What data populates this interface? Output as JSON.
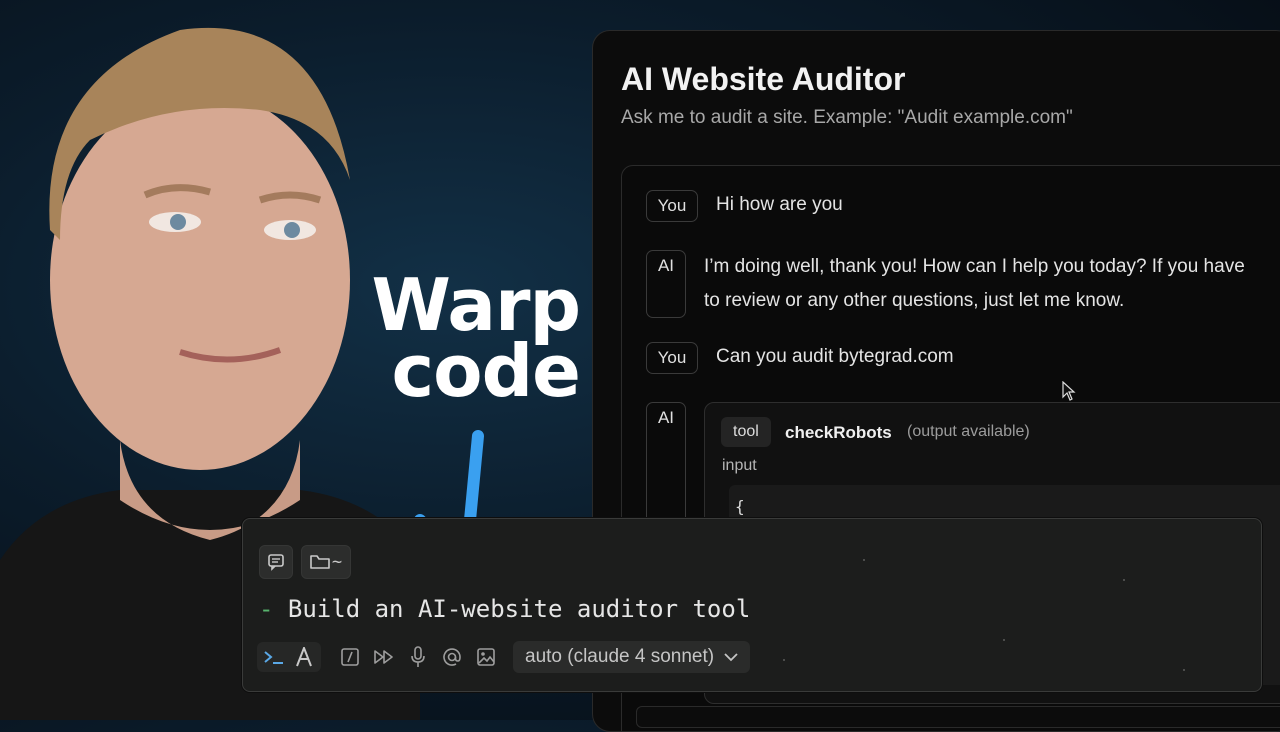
{
  "overlay": {
    "line1": "Warp",
    "line2": "code"
  },
  "auditor": {
    "title": "AI Website Auditor",
    "subtitle": "Ask me to audit a site. Example: \"Audit example.com\"",
    "messages": [
      {
        "role": "You",
        "text": "Hi how are you"
      },
      {
        "role": "AI",
        "line1": "I’m doing well, thank you! How can I help you today? If you have",
        "line2": "to review or any other questions, just let me know."
      },
      {
        "role": "You",
        "text": "Can you audit bytegrad.com"
      },
      {
        "role": "AI"
      }
    ],
    "tool": {
      "badge": "tool",
      "name": "checkRobots",
      "status": "(output available)",
      "input_label": "input",
      "code_first_line": "{"
    }
  },
  "warp": {
    "directory": "~",
    "prompt_prefix": "-",
    "prompt_text": " Build an AI-website auditor tool",
    "model": "auto (claude 4 sonnet)",
    "icons": [
      "chat-icon",
      "folder-icon",
      "terminal-icon",
      "agent-icon",
      "slash-icon",
      "fast-forward-icon",
      "microphone-icon",
      "at-icon",
      "image-icon",
      "chevron-down-icon"
    ]
  },
  "colors": {
    "accent_arrow": "#3aa0f0",
    "prompt_dash": "#57b36d"
  }
}
